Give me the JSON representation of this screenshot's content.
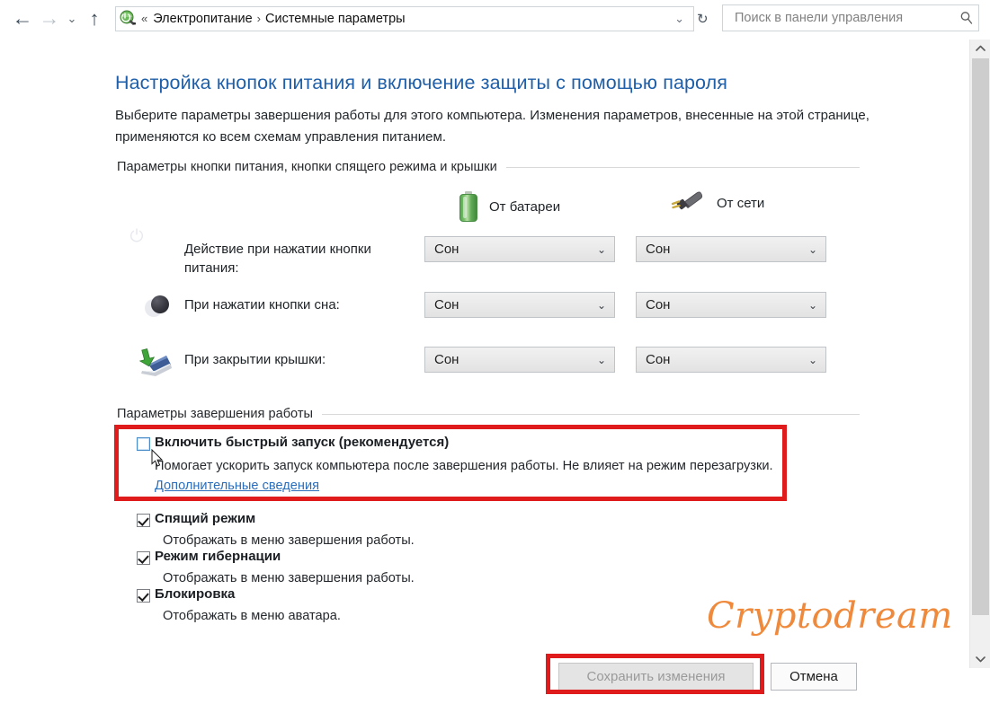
{
  "navbar": {
    "back_icon": "arrow-left-icon",
    "forward_icon": "arrow-right-icon",
    "history_icon": "chevron-down-icon",
    "up_icon": "arrow-up-icon",
    "address_icon": "power-options-icon",
    "breadcrumb_prefix": "«",
    "breadcrumbs": [
      "Электропитание",
      "Системные параметры"
    ],
    "breadcrumb_separator": "›",
    "dropdown_icon": "chevron-down-icon",
    "refresh_icon": "refresh-icon",
    "refresh_glyph": "↻"
  },
  "search": {
    "placeholder": "Поиск в панели управления",
    "value": "",
    "icon": "search-icon"
  },
  "scrollbar": {
    "up_icon": "chevron-up-icon",
    "down_icon": "chevron-down-icon"
  },
  "page": {
    "title": "Настройка кнопок питания и включение защиты с помощью пароля",
    "description": "Выберите параметры завершения работы для этого компьютера. Изменения параметров, внесенные на этой странице, применяются ко всем схемам управления питанием."
  },
  "groups": {
    "power_buttons": "Параметры кнопки питания, кнопки спящего режима и крышки",
    "shutdown": "Параметры завершения работы"
  },
  "columns": [
    {
      "label": "От батареи",
      "icon": "battery-icon"
    },
    {
      "label": "От сети",
      "icon": "power-plug-icon"
    }
  ],
  "rows": [
    {
      "icon": "power-button-icon",
      "label": "Действие при нажатии кнопки питания:",
      "battery_value": "Сон",
      "ac_value": "Сон",
      "caret": "⌄"
    },
    {
      "icon": "sleep-moon-icon",
      "label": "При нажатии кнопки сна:",
      "battery_value": "Сон",
      "ac_value": "Сон",
      "caret": "⌄"
    },
    {
      "icon": "laptop-lid-icon",
      "label": "При закрытии крышки:",
      "battery_value": "Сон",
      "ac_value": "Сон",
      "caret": "⌄"
    }
  ],
  "shutdown_options": [
    {
      "title": "Включить быстрый запуск (рекомендуется)",
      "checked": false,
      "hovered": true,
      "desc_before": "Помогает ускорить запуск компьютера после завершения работы. Не влияет на режим перезагрузки. ",
      "link": "Дополнительные сведения",
      "highlighted": true
    },
    {
      "title": "Спящий режим",
      "checked": true,
      "hovered": false,
      "desc_before": "Отображать в меню завершения работы.",
      "link": "",
      "highlighted": false
    },
    {
      "title": "Режим гибернации",
      "checked": true,
      "hovered": false,
      "desc_before": "Отображать в меню завершения работы.",
      "link": "",
      "highlighted": false
    },
    {
      "title": "Блокировка",
      "checked": true,
      "hovered": false,
      "desc_before": "Отображать в меню аватара.",
      "link": "",
      "highlighted": false
    }
  ],
  "buttons": {
    "save": "Сохранить изменения",
    "save_disabled": true,
    "cancel": "Отмена"
  },
  "watermark": {
    "text": "Cryptodream"
  },
  "colors": {
    "title_blue": "#1f5fa9",
    "link_blue": "#2a6dbb",
    "highlight_red": "#e01b1b",
    "battery_green": "#59a752",
    "watermark_orange": "#ef8a3c"
  }
}
